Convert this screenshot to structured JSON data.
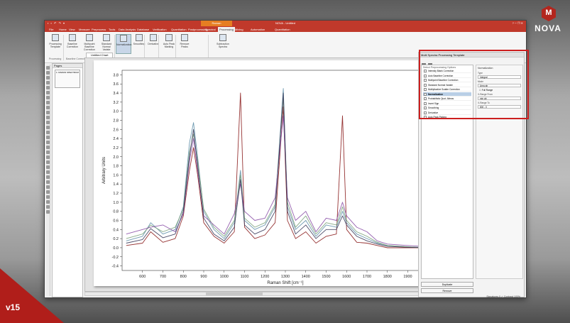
{
  "app": {
    "title": "NOVA - Untitled",
    "quick_access": "▪ ▪ ↶ ↷ ▾",
    "context_tab": "Raman",
    "window_controls": "? ─ ❐ ✕"
  },
  "menu_tabs": [
    "File",
    "Home",
    "View",
    "Measure",
    "Preprocess",
    "Tools",
    "Data Analysis",
    "Database",
    "Verification",
    "Quantitation",
    "Postprocessing",
    "Spectral",
    "Processing",
    "Mixing",
    "Automation",
    "Quantitation"
  ],
  "ribbon": {
    "buttons": [
      "Processing Template",
      "Baseline Correction",
      "Multipoint Baseline Correction",
      "Standard Normal Variate",
      "Normalization",
      "Smoothing",
      "Derivative",
      "Auto Peak Marking",
      "Remove Peaks",
      "Subtraction Spectra"
    ],
    "groups": [
      "Processing",
      "Baseline Correction",
      "Normalization",
      "Smoothing",
      "Derivative",
      "Peaks",
      "Integrate",
      "Subtraction Spectra"
    ]
  },
  "pages_panel": {
    "title": "Pages",
    "thumb_label": "1: RAMAN SPECTRUM"
  },
  "document_tab": "Untitled Chart",
  "right_panel": {
    "title": "Multi Spectra Processing Template",
    "list_header": "Select Preprocessing Options",
    "items": [
      {
        "label": "Intensity Blank Correction",
        "selected": false
      },
      {
        "label": "Auto Baseline Correction",
        "selected": false
      },
      {
        "label": "Multipoint Baseline Correction",
        "selected": false
      },
      {
        "label": "Standard Normal Variate",
        "selected": false
      },
      {
        "label": "Multiplicative Scatter Correction",
        "selected": false
      },
      {
        "label": "Normalization",
        "selected": true
      },
      {
        "label": "Probabilistic Quot. Allmos",
        "selected": false
      },
      {
        "label": "Invert Sign",
        "selected": false
      },
      {
        "label": "Smoothing",
        "selected": false
      },
      {
        "label": "Derivative",
        "selected": false
      },
      {
        "label": "Auto Peak Picking",
        "selected": false
      }
    ],
    "settings": {
      "title": "Normalization",
      "fields": [
        {
          "label": "Type",
          "value": "Integral"
        },
        {
          "label": "Mode",
          "value": "Area ab"
        },
        {
          "label": "X-Range From",
          "value": "min ab"
        },
        {
          "label": "X-Range To",
          "value": "800 - 0"
        }
      ],
      "checkbox_label": "Full Range"
    },
    "buttons": [
      "Duplicate",
      "Remove"
    ]
  },
  "status": "Signatures 0 ✓ Contrast 100%",
  "branding": {
    "logo_letter": "M",
    "logo_text": "NOVA",
    "version": "v15"
  },
  "chart_data": {
    "type": "line",
    "xlabel": "Raman Shift [cm⁻¹]",
    "ylabel": "Arbitrary Units",
    "xlim": [
      500,
      2100
    ],
    "ylim": [
      -0.5,
      3.9
    ],
    "xticks": [
      600,
      700,
      800,
      900,
      1000,
      1100,
      1200,
      1300,
      1400,
      1500,
      1600,
      1700,
      1800,
      1900,
      2000
    ],
    "yticks": [
      -0.4,
      -0.2,
      0.0,
      0.2,
      0.4,
      0.6,
      0.8,
      1.0,
      1.2,
      1.4,
      1.6,
      1.8,
      2.0,
      2.2,
      2.4,
      2.6,
      2.8,
      3.0,
      3.2,
      3.4,
      3.6,
      3.8
    ],
    "grid": false,
    "series": [
      {
        "color": "#8b1d1d",
        "x": [
          520,
          600,
          640,
          700,
          760,
          800,
          830,
          850,
          870,
          900,
          950,
          1000,
          1050,
          1080,
          1100,
          1150,
          1200,
          1250,
          1290,
          1310,
          1350,
          1400,
          1450,
          1500,
          1550,
          1580,
          1600,
          1650,
          1700,
          1750,
          1800,
          1900,
          2000,
          2100
        ],
        "y": [
          0.05,
          0.1,
          0.35,
          0.12,
          0.2,
          0.7,
          1.7,
          2.2,
          1.6,
          0.55,
          0.25,
          0.1,
          0.35,
          3.4,
          0.45,
          0.2,
          0.28,
          0.55,
          3.1,
          0.6,
          0.2,
          0.35,
          0.1,
          0.25,
          0.3,
          2.9,
          0.4,
          0.12,
          0.1,
          0.05,
          0.0,
          0.0,
          0.0,
          0.0
        ]
      },
      {
        "color": "#5e8fa8",
        "x": [
          520,
          600,
          640,
          700,
          760,
          800,
          830,
          850,
          870,
          900,
          950,
          1000,
          1050,
          1080,
          1100,
          1150,
          1200,
          1250,
          1290,
          1310,
          1350,
          1400,
          1450,
          1500,
          1550,
          1580,
          1600,
          1650,
          1700,
          1750,
          1800,
          1900,
          2000,
          2100
        ],
        "y": [
          0.15,
          0.25,
          0.55,
          0.3,
          0.4,
          0.9,
          2.3,
          2.75,
          2.0,
          0.8,
          0.4,
          0.2,
          0.55,
          1.7,
          0.6,
          0.4,
          0.5,
          0.9,
          3.5,
          0.9,
          0.4,
          0.6,
          0.25,
          0.5,
          0.45,
          0.8,
          0.55,
          0.3,
          0.2,
          0.1,
          0.05,
          0.02,
          0.0,
          0.0
        ]
      },
      {
        "color": "#7aa17a",
        "x": [
          520,
          600,
          640,
          700,
          760,
          800,
          830,
          850,
          870,
          900,
          950,
          1000,
          1050,
          1080,
          1100,
          1150,
          1200,
          1250,
          1290,
          1310,
          1350,
          1400,
          1450,
          1500,
          1550,
          1580,
          1600,
          1650,
          1700,
          1750,
          1800,
          1900,
          2000,
          2100
        ],
        "y": [
          0.2,
          0.3,
          0.5,
          0.35,
          0.45,
          0.85,
          2.1,
          2.5,
          1.9,
          0.85,
          0.45,
          0.25,
          0.6,
          1.6,
          0.65,
          0.45,
          0.55,
          0.95,
          3.3,
          1.0,
          0.45,
          0.7,
          0.3,
          0.55,
          0.5,
          0.9,
          0.6,
          0.35,
          0.25,
          0.12,
          0.05,
          0.02,
          0.0,
          0.0
        ]
      },
      {
        "color": "#8a4fa6",
        "x": [
          520,
          600,
          640,
          700,
          760,
          800,
          830,
          850,
          870,
          900,
          950,
          1000,
          1050,
          1080,
          1100,
          1150,
          1200,
          1250,
          1290,
          1310,
          1350,
          1400,
          1450,
          1500,
          1550,
          1580,
          1600,
          1650,
          1700,
          1750,
          1800,
          1900,
          2000,
          2100
        ],
        "y": [
          0.3,
          0.4,
          0.45,
          0.5,
          0.35,
          0.75,
          1.9,
          2.4,
          1.7,
          0.7,
          0.5,
          0.3,
          0.75,
          1.4,
          0.8,
          0.6,
          0.65,
          1.1,
          2.9,
          1.1,
          0.6,
          0.8,
          0.35,
          0.65,
          0.6,
          1.0,
          0.7,
          0.45,
          0.35,
          0.15,
          0.08,
          0.05,
          0.02,
          0.0
        ]
      },
      {
        "color": "#3a3a5a",
        "x": [
          520,
          600,
          640,
          700,
          760,
          800,
          830,
          850,
          870,
          900,
          950,
          1000,
          1050,
          1080,
          1100,
          1150,
          1200,
          1250,
          1290,
          1310,
          1350,
          1400,
          1450,
          1500,
          1550,
          1580,
          1600,
          1650,
          1700,
          1750,
          1800,
          1900,
          2000,
          2100
        ],
        "y": [
          0.1,
          0.18,
          0.42,
          0.22,
          0.3,
          0.8,
          2.0,
          2.6,
          1.8,
          0.65,
          0.3,
          0.15,
          0.45,
          1.5,
          0.5,
          0.3,
          0.4,
          0.8,
          3.4,
          0.8,
          0.3,
          0.5,
          0.2,
          0.4,
          0.4,
          0.7,
          0.5,
          0.25,
          0.15,
          0.08,
          0.03,
          0.01,
          0.0,
          0.0
        ]
      }
    ]
  }
}
